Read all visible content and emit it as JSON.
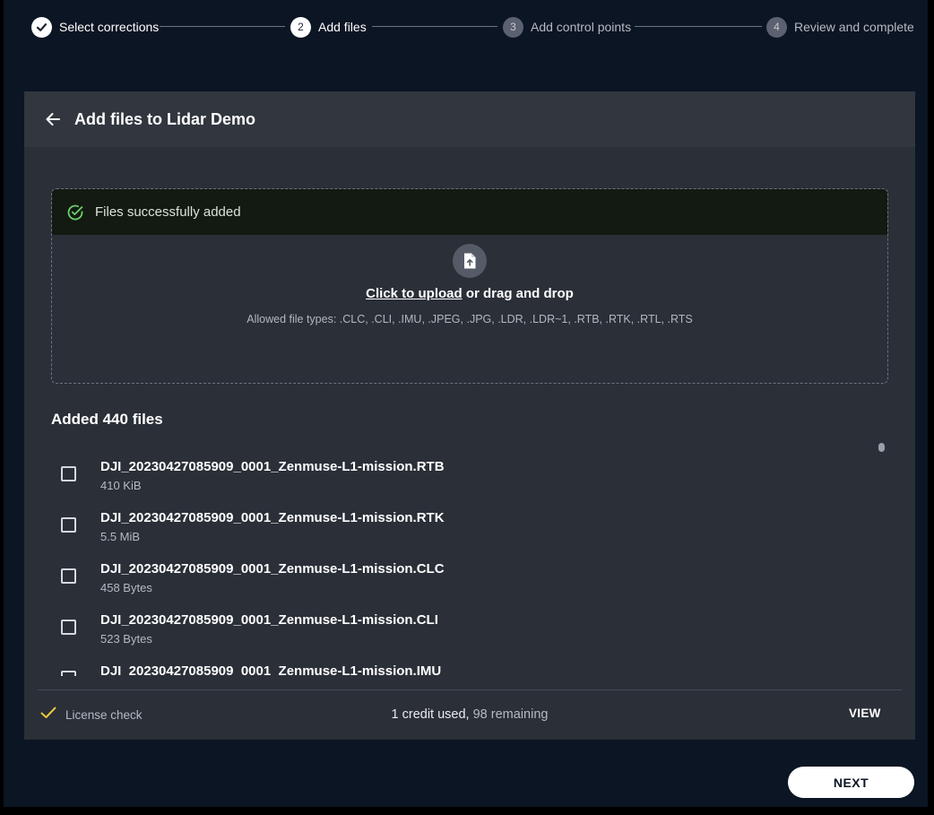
{
  "stepper": {
    "steps": [
      {
        "number": "",
        "label": "Select corrections",
        "state": "done"
      },
      {
        "number": "2",
        "label": "Add files",
        "state": "active"
      },
      {
        "number": "3",
        "label": "Add control points",
        "state": "pending"
      },
      {
        "number": "4",
        "label": "Review and complete",
        "state": "pending"
      }
    ]
  },
  "card": {
    "title": "Add files to Lidar Demo",
    "back_icon": "arrow-left-icon"
  },
  "dropzone": {
    "success_message": "Files successfully added",
    "upload_link": "Click to upload",
    "upload_suffix": " or drag and drop",
    "allowed_types": "Allowed file types: .CLC, .CLI, .IMU, .JPEG, .JPG, .LDR, .LDR~1, .RTB, .RTK, .RTL, .RTS"
  },
  "files": {
    "title": "Added 440 files",
    "items": [
      {
        "name": "DJI_20230427085909_0001_Zenmuse-L1-mission.RTB",
        "size": "410 KiB"
      },
      {
        "name": "DJI_20230427085909_0001_Zenmuse-L1-mission.RTK",
        "size": "5.5 MiB"
      },
      {
        "name": "DJI_20230427085909_0001_Zenmuse-L1-mission.CLC",
        "size": "458 Bytes"
      },
      {
        "name": "DJI_20230427085909_0001_Zenmuse-L1-mission.CLI",
        "size": "523 Bytes"
      },
      {
        "name": "DJI_20230427085909_0001_Zenmuse-L1-mission.IMU",
        "size": ""
      }
    ]
  },
  "footer": {
    "license_label": "License check",
    "credits_used": "1 credit used,",
    "credits_remaining": " 98 remaining",
    "view_label": "VIEW"
  },
  "actions": {
    "next_label": "NEXT"
  },
  "colors": {
    "background": "#0c1523",
    "card": "#2a2f38",
    "success": "#6fcf6a",
    "check_accent": "#e8c93b"
  }
}
